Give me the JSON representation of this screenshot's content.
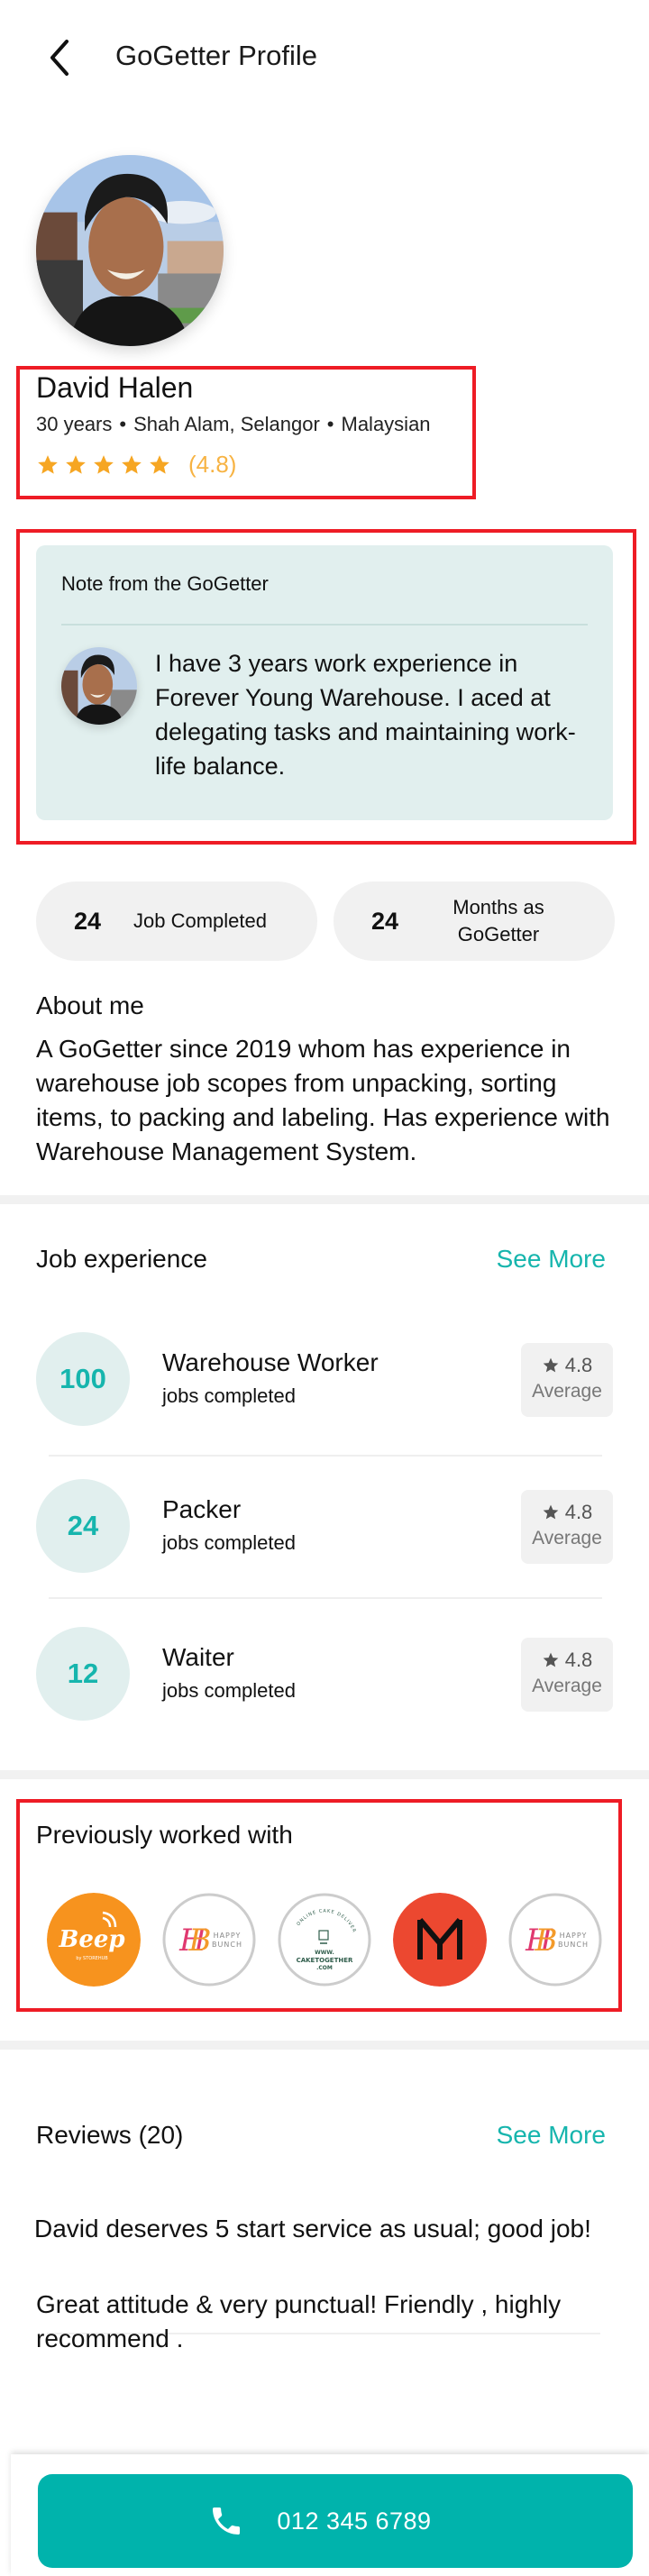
{
  "header": {
    "title": "GoGetter Profile",
    "back_icon": "chevron-left-icon"
  },
  "profile": {
    "name": "David Halen",
    "age": "30 years",
    "location": "Shah Alam, Selangor",
    "nationality": "Malaysian",
    "separator": "•",
    "rating_stars": 5,
    "rating_text": "(4.8)"
  },
  "note": {
    "title": "Note from the GoGetter",
    "text": "I have 3 years work experience in Forever Young Warehouse. I aced at delegating tasks and maintaining work-life balance."
  },
  "stats": [
    {
      "value": "24",
      "label": "Job Completed"
    },
    {
      "value": "24",
      "label": "Months as GoGetter"
    }
  ],
  "about": {
    "title": "About me",
    "text": "A GoGetter since 2019 whom has experience in warehouse job scopes from unpacking, sorting items, to packing and labeling. Has experience with Warehouse Management System."
  },
  "job_experience": {
    "title": "Job experience",
    "see_more": "See More",
    "items": [
      {
        "count": "100",
        "title": "Warehouse Worker",
        "subtitle": "jobs completed",
        "rating": "4.8",
        "rating_label": "Average"
      },
      {
        "count": "24",
        "title": "Packer",
        "subtitle": "jobs completed",
        "rating": "4.8",
        "rating_label": "Average"
      },
      {
        "count": "12",
        "title": "Waiter",
        "subtitle": "jobs completed",
        "rating": "4.8",
        "rating_label": "Average"
      }
    ]
  },
  "previously_worked_with": {
    "title": "Previously worked with",
    "logos": [
      {
        "name": "Beep",
        "sub": "by STOREHUB",
        "bg": "#f7931e"
      },
      {
        "name": "HAPPY BUNCH",
        "bg": "#ffffff"
      },
      {
        "name": "CAKETOGETHER",
        "sub": "WWW.",
        "sub2": ".COM",
        "arc": "ONLINE CAKE DELIVERY",
        "bg": "#ffffff"
      },
      {
        "name": "M",
        "bg": "#ec4830"
      },
      {
        "name": "HAPPY BUNCH",
        "bg": "#ffffff"
      }
    ]
  },
  "reviews": {
    "title": "Reviews (20)",
    "see_more": "See More",
    "items": [
      "David deserves 5 start service as usual; good job!",
      "Great attitude & very punctual! Friendly , highly recommend ."
    ]
  },
  "call": {
    "phone": "012 345 6789",
    "icon": "phone-icon"
  },
  "colors": {
    "accent": "#16b5ad",
    "button": "#00b3ac",
    "star": "#f6a623",
    "note_bg": "#e1efee",
    "highlight": "#ee1c25"
  }
}
